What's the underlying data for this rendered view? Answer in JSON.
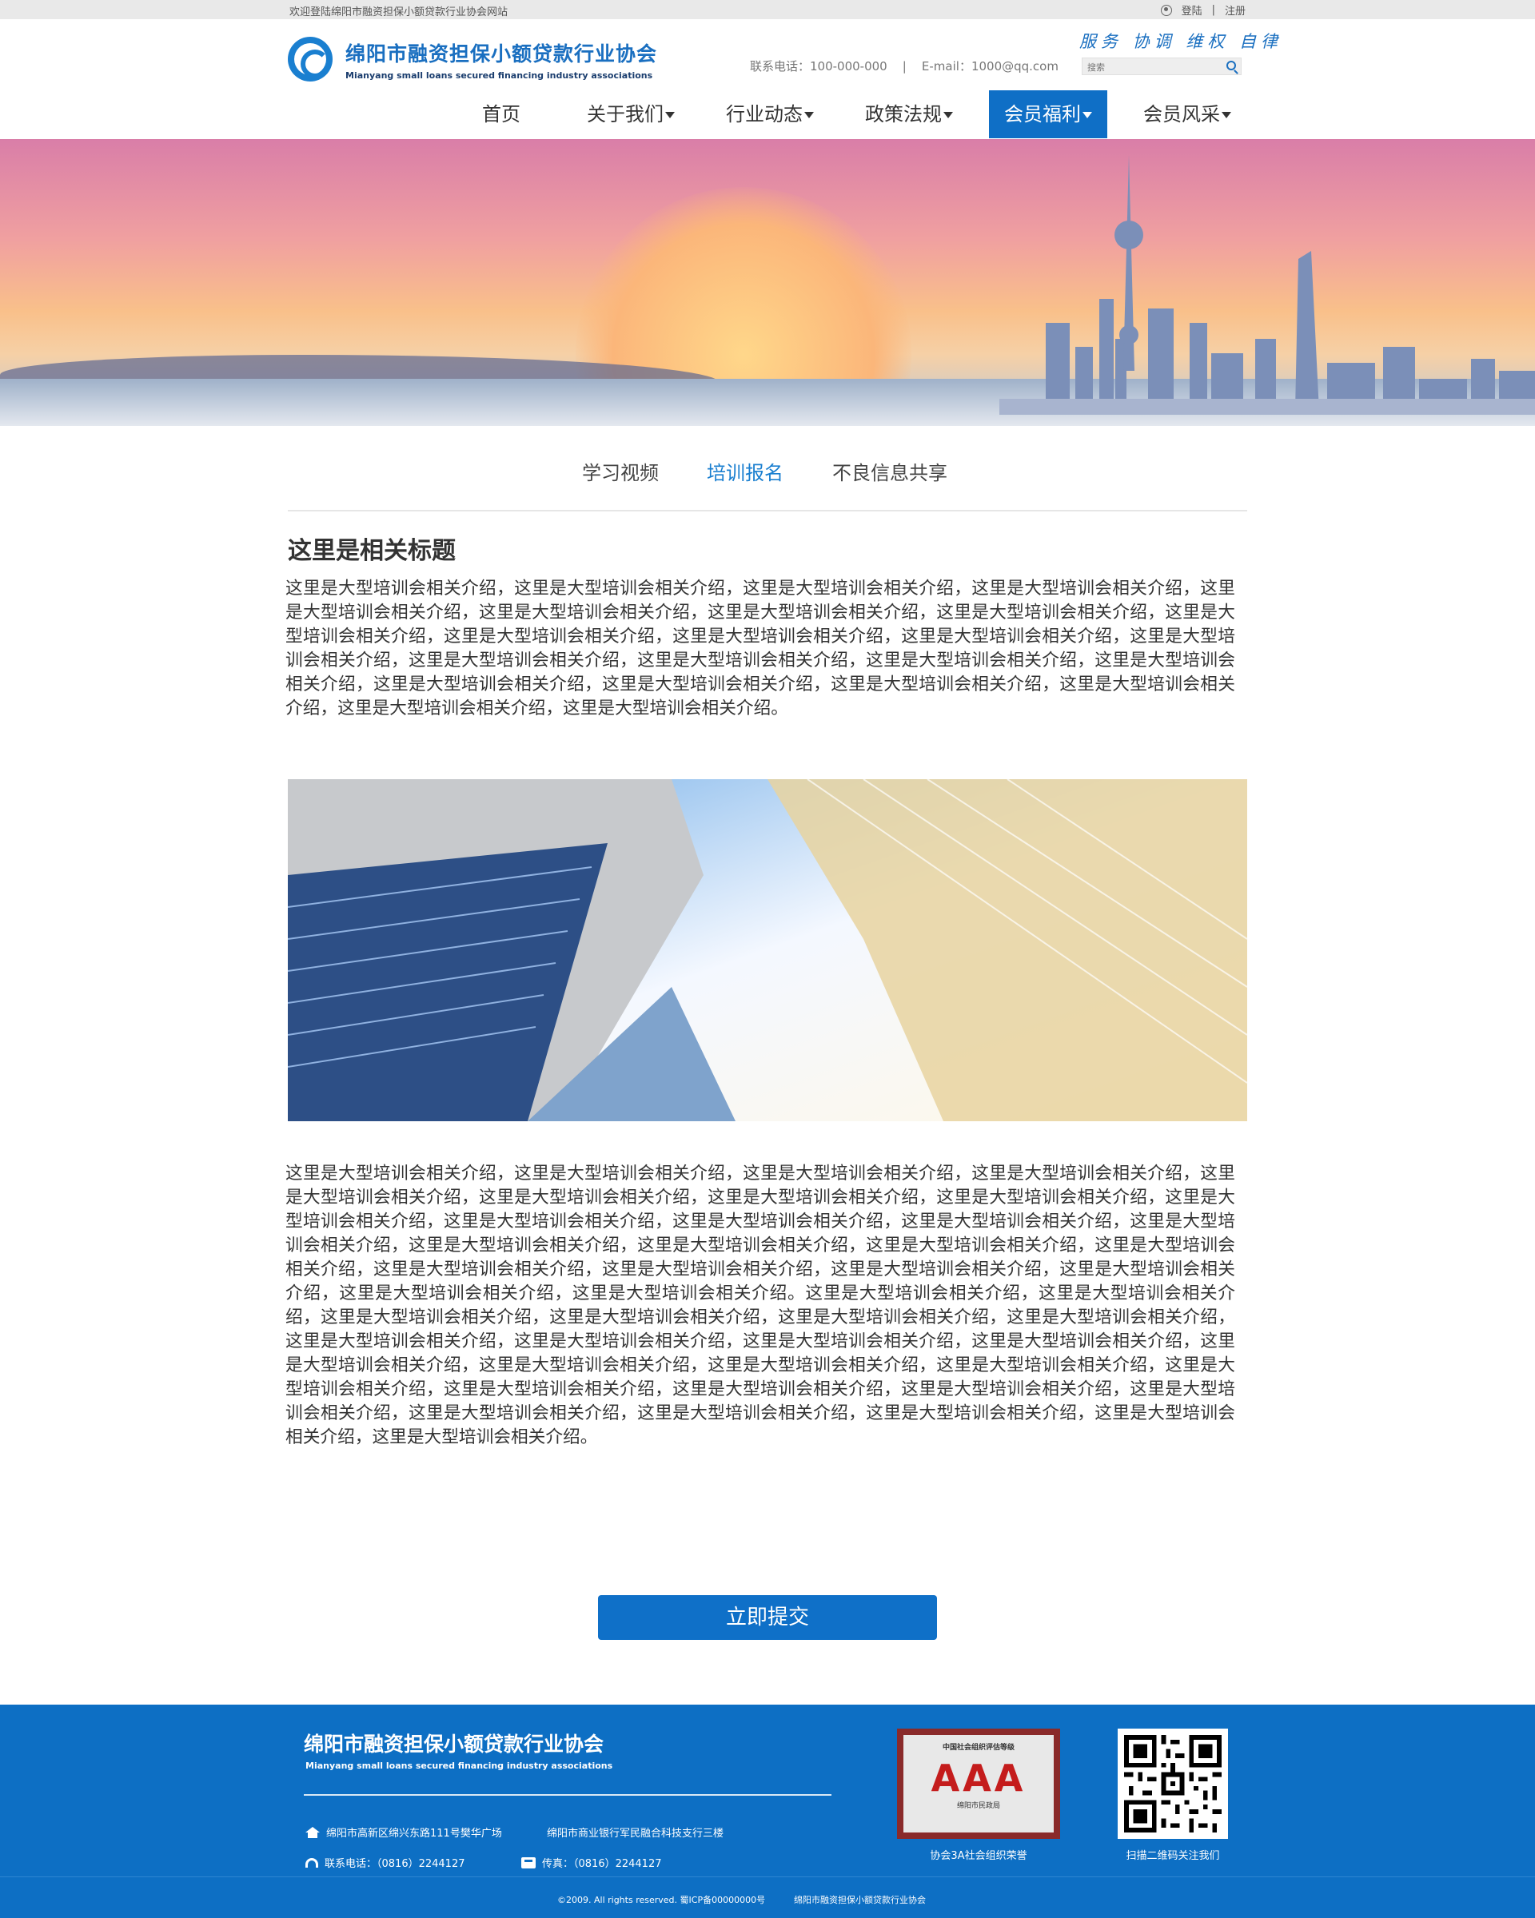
{
  "topbar": {
    "welcome": "欢迎登陆绵阳市融资担保小额贷款行业协会网站",
    "login": "登陆",
    "separator": "|",
    "register": "注册"
  },
  "header": {
    "org_name_cn": "绵阳市融资担保小额贷款行业协会",
    "org_name_en": "Mianyang small loans secured financing industry associations",
    "contact": "联系电话：100-000-000    |    E-mail：1000@qq.com",
    "slogan": "服务 协调 维权 自律",
    "search_placeholder": "搜索"
  },
  "nav": {
    "items": [
      {
        "label": "首页"
      },
      {
        "label": "关于我们"
      },
      {
        "label": "行业动态"
      },
      {
        "label": "政策法规"
      },
      {
        "label": "会员福利"
      },
      {
        "label": "会员风采"
      }
    ],
    "active": "会员福利"
  },
  "subtabs": {
    "items": [
      {
        "label": "学习视频"
      },
      {
        "label": "培训报名"
      },
      {
        "label": "不良信息共享"
      }
    ],
    "active": "培训报名"
  },
  "article": {
    "title": "这里是相关标题",
    "para1": "这里是大型培训会相关介绍，这里是大型培训会相关介绍，这里是大型培训会相关介绍，这里是大型培训会相关介绍，这里是大型培训会相关介绍，这里是大型培训会相关介绍，这里是大型培训会相关介绍，这里是大型培训会相关介绍，这里是大型培训会相关介绍，这里是大型培训会相关介绍，这里是大型培训会相关介绍，这里是大型培训会相关介绍，这里是大型培训会相关介绍，这里是大型培训会相关介绍，这里是大型培训会相关介绍，这里是大型培训会相关介绍，这里是大型培训会相关介绍，这里是大型培训会相关介绍，这里是大型培训会相关介绍，这里是大型培训会相关介绍，这里是大型培训会相关介绍，这里是大型培训会相关介绍，这里是大型培训会相关介绍。",
    "para2": "这里是大型培训会相关介绍，这里是大型培训会相关介绍，这里是大型培训会相关介绍，这里是大型培训会相关介绍，这里是大型培训会相关介绍，这里是大型培训会相关介绍，这里是大型培训会相关介绍，这里是大型培训会相关介绍，这里是大型培训会相关介绍，这里是大型培训会相关介绍，这里是大型培训会相关介绍，这里是大型培训会相关介绍，这里是大型培训会相关介绍，这里是大型培训会相关介绍，这里是大型培训会相关介绍，这里是大型培训会相关介绍，这里是大型培训会相关介绍，这里是大型培训会相关介绍，这里是大型培训会相关介绍，这里是大型培训会相关介绍，这里是大型培训会相关介绍，这里是大型培训会相关介绍，这里是大型培训会相关介绍。这里是大型培训会相关介绍，这里是大型培训会相关介绍，这里是大型培训会相关介绍，这里是大型培训会相关介绍，这里是大型培训会相关介绍，这里是大型培训会相关介绍，这里是大型培训会相关介绍，这里是大型培训会相关介绍，这里是大型培训会相关介绍，这里是大型培训会相关介绍，这里是大型培训会相关介绍，这里是大型培训会相关介绍，这里是大型培训会相关介绍，这里是大型培训会相关介绍，这里是大型培训会相关介绍，这里是大型培训会相关介绍，这里是大型培训会相关介绍，这里是大型培训会相关介绍，这里是大型培训会相关介绍，这里是大型培训会相关介绍，这里是大型培训会相关介绍，这里是大型培训会相关介绍，这里是大型培训会相关介绍，这里是大型培训会相关介绍。",
    "submit_label": "立即提交"
  },
  "footer": {
    "org_name_cn": "绵阳市融资担保小额贷款行业协会",
    "org_name_en": "Mianyang small loans secured financing industry associations",
    "address1": "绵阳市高新区绵兴东路111号樊华广场",
    "address2": "绵阳市商业银行军民融合科技支行三楼",
    "tel": "联系电话：（0816）2244127",
    "fax": "传真：（0816）2244127",
    "cert_top": "中国社会组织评估等级",
    "cert_grade": "AAA",
    "cert_issuer": "绵阳市民政局",
    "cert_label": "协会3A社会组织荣誉",
    "qr_label": "扫描二维码关注我们"
  },
  "copyright": {
    "text1": "©2009. All rights reserved. 蜀ICP备00000000号",
    "text2": "绵阳市融资担保小额贷款行业协会"
  },
  "colors": {
    "brand_blue": "#0f6fc6",
    "active_tab": "#1a7fd0",
    "topbar_bg": "#e9e9e9"
  }
}
